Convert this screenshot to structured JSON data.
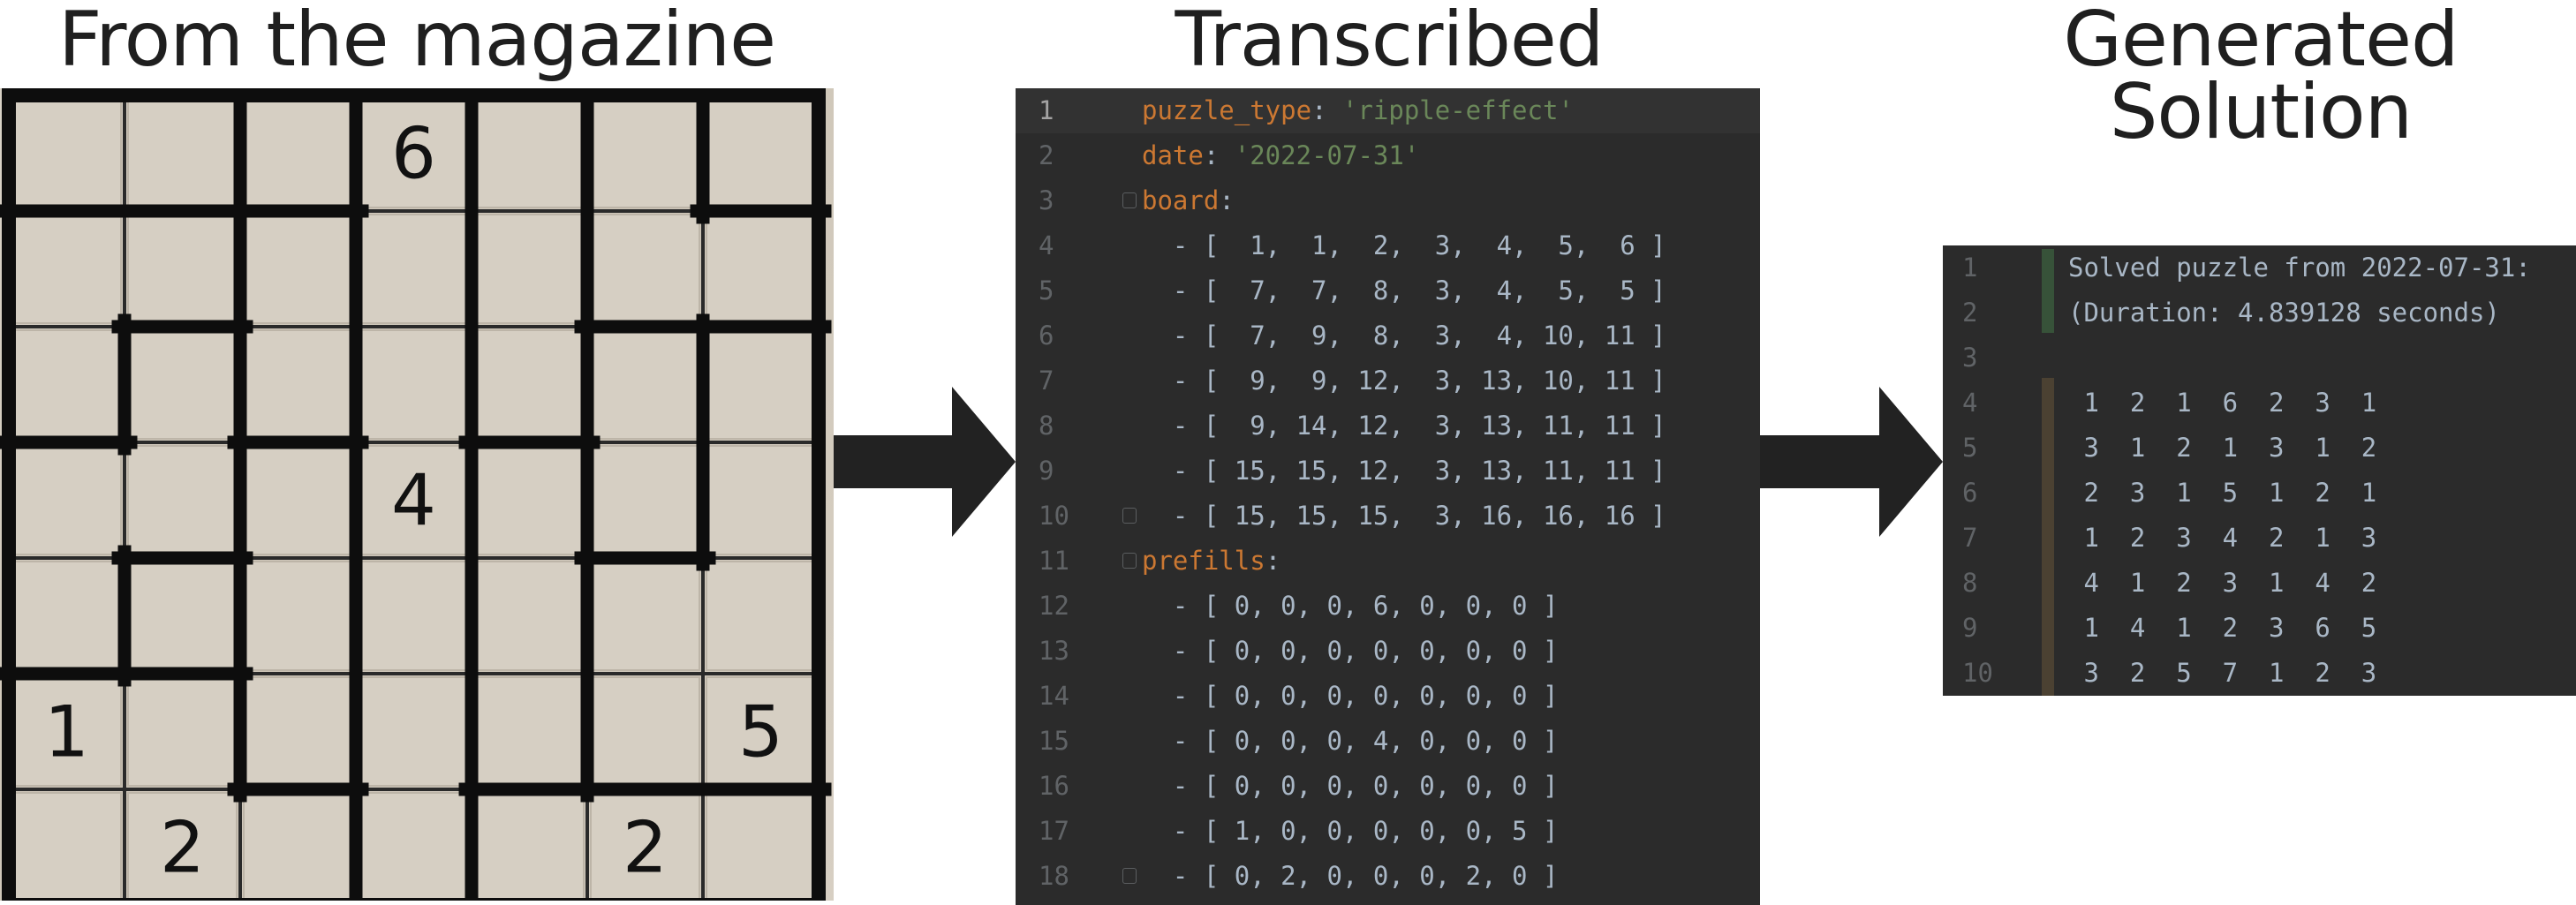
{
  "headings": {
    "magazine": "From the magazine",
    "transcribed": "Transcribed",
    "solution_line1": "Generated",
    "solution_line2": "Solution"
  },
  "magazine_puzzle": {
    "rows": 7,
    "cols": 7,
    "board": [
      [
        1,
        1,
        2,
        3,
        4,
        5,
        6
      ],
      [
        7,
        7,
        8,
        3,
        4,
        5,
        5
      ],
      [
        7,
        9,
        8,
        3,
        4,
        10,
        11
      ],
      [
        9,
        9,
        12,
        3,
        13,
        10,
        11
      ],
      [
        9,
        14,
        12,
        3,
        13,
        11,
        11
      ],
      [
        15,
        15,
        12,
        3,
        13,
        11,
        11
      ],
      [
        15,
        15,
        15,
        3,
        16,
        16,
        16
      ]
    ],
    "prefills": [
      [
        0,
        0,
        0,
        6,
        0,
        0,
        0
      ],
      [
        0,
        0,
        0,
        0,
        0,
        0,
        0
      ],
      [
        0,
        0,
        0,
        0,
        0,
        0,
        0
      ],
      [
        0,
        0,
        0,
        4,
        0,
        0,
        0
      ],
      [
        0,
        0,
        0,
        0,
        0,
        0,
        0
      ],
      [
        1,
        0,
        0,
        0,
        0,
        0,
        5
      ],
      [
        0,
        2,
        0,
        0,
        0,
        2,
        0
      ]
    ],
    "colors": {
      "paper": "#d6cfc3",
      "ink": "#0d0d0d"
    }
  },
  "editor": {
    "colors": {
      "background": "#2b2b2b",
      "key": "#cc7832",
      "string": "#6a8759",
      "text": "#a9b7c6",
      "line_number": "#606366"
    },
    "lines": [
      {
        "num": "1",
        "current": true,
        "fold": false,
        "parts": [
          {
            "t": "puzzle_type",
            "c": "k"
          },
          {
            "t": ": ",
            "c": ""
          },
          {
            "t": "'ripple-effect'",
            "c": "s"
          }
        ]
      },
      {
        "num": "2",
        "fold": false,
        "parts": [
          {
            "t": "date",
            "c": "k"
          },
          {
            "t": ": ",
            "c": ""
          },
          {
            "t": "'2022-07-31'",
            "c": "s"
          }
        ]
      },
      {
        "num": "3",
        "fold": true,
        "parts": [
          {
            "t": "board",
            "c": "k"
          },
          {
            "t": ":",
            "c": ""
          }
        ]
      },
      {
        "num": "4",
        "fold": false,
        "parts": [
          {
            "t": "  - [  1,  1,  2,  3,  4,  5,  6 ]",
            "c": ""
          }
        ]
      },
      {
        "num": "5",
        "fold": false,
        "parts": [
          {
            "t": "  - [  7,  7,  8,  3,  4,  5,  5 ]",
            "c": ""
          }
        ]
      },
      {
        "num": "6",
        "fold": false,
        "parts": [
          {
            "t": "  - [  7,  9,  8,  3,  4, 10, 11 ]",
            "c": ""
          }
        ]
      },
      {
        "num": "7",
        "fold": false,
        "parts": [
          {
            "t": "  - [  9,  9, 12,  3, 13, 10, 11 ]",
            "c": ""
          }
        ]
      },
      {
        "num": "8",
        "fold": false,
        "parts": [
          {
            "t": "  - [  9, 14, 12,  3, 13, 11, 11 ]",
            "c": ""
          }
        ]
      },
      {
        "num": "9",
        "fold": false,
        "parts": [
          {
            "t": "  - [ 15, 15, 12,  3, 13, 11, 11 ]",
            "c": ""
          }
        ]
      },
      {
        "num": "10",
        "fold": true,
        "parts": [
          {
            "t": "  - [ 15, 15, 15,  3, 16, 16, 16 ]",
            "c": ""
          }
        ]
      },
      {
        "num": "11",
        "fold": true,
        "parts": [
          {
            "t": "prefills",
            "c": "k"
          },
          {
            "t": ":",
            "c": ""
          }
        ]
      },
      {
        "num": "12",
        "fold": false,
        "parts": [
          {
            "t": "  - [ 0, 0, 0, 6, 0, 0, 0 ]",
            "c": ""
          }
        ]
      },
      {
        "num": "13",
        "fold": false,
        "parts": [
          {
            "t": "  - [ 0, 0, 0, 0, 0, 0, 0 ]",
            "c": ""
          }
        ]
      },
      {
        "num": "14",
        "fold": false,
        "parts": [
          {
            "t": "  - [ 0, 0, 0, 0, 0, 0, 0 ]",
            "c": ""
          }
        ]
      },
      {
        "num": "15",
        "fold": false,
        "parts": [
          {
            "t": "  - [ 0, 0, 0, 4, 0, 0, 0 ]",
            "c": ""
          }
        ]
      },
      {
        "num": "16",
        "fold": false,
        "parts": [
          {
            "t": "  - [ 0, 0, 0, 0, 0, 0, 0 ]",
            "c": ""
          }
        ]
      },
      {
        "num": "17",
        "fold": false,
        "parts": [
          {
            "t": "  - [ 1, 0, 0, 0, 0, 0, 5 ]",
            "c": ""
          }
        ]
      },
      {
        "num": "18",
        "fold": true,
        "parts": [
          {
            "t": "  - [ 0, 2, 0, 0, 0, 2, 0 ]",
            "c": ""
          }
        ]
      }
    ]
  },
  "console": {
    "lines": [
      {
        "num": "1",
        "text": "Solved puzzle from 2022-07-31:"
      },
      {
        "num": "2",
        "text": "(Duration: 4.839128 seconds)"
      },
      {
        "num": "3",
        "text": ""
      },
      {
        "num": "4",
        "text": " 1  2  1  6  2  3  1"
      },
      {
        "num": "5",
        "text": " 3  1  2  1  3  1  2"
      },
      {
        "num": "6",
        "text": " 2  3  1  5  1  2  1"
      },
      {
        "num": "7",
        "text": " 1  2  3  4  2  1  3"
      },
      {
        "num": "8",
        "text": " 4  1  2  3  1  4  2"
      },
      {
        "num": "9",
        "text": " 1  4  1  2  3  6  5"
      },
      {
        "num": "10",
        "text": " 3  2  5  7  1  2  3"
      }
    ]
  }
}
